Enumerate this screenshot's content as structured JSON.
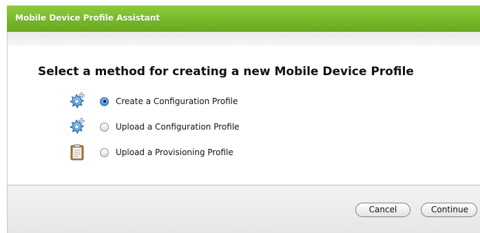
{
  "window": {
    "title": "Mobile Device Profile Assistant"
  },
  "main": {
    "heading": "Select a method for creating a new Mobile Device Profile",
    "options": [
      {
        "label": "Create a Configuration Profile",
        "selected": true,
        "icon": "gear-plus-icon"
      },
      {
        "label": "Upload a Configuration Profile",
        "selected": false,
        "icon": "gear-plus-icon"
      },
      {
        "label": "Upload a Provisioning Profile",
        "selected": false,
        "icon": "clipboard-icon"
      }
    ]
  },
  "footer": {
    "cancel_label": "Cancel",
    "continue_label": "Continue"
  },
  "colors": {
    "title_green": "#79bb2b",
    "radio_blue": "#4d92dd"
  }
}
